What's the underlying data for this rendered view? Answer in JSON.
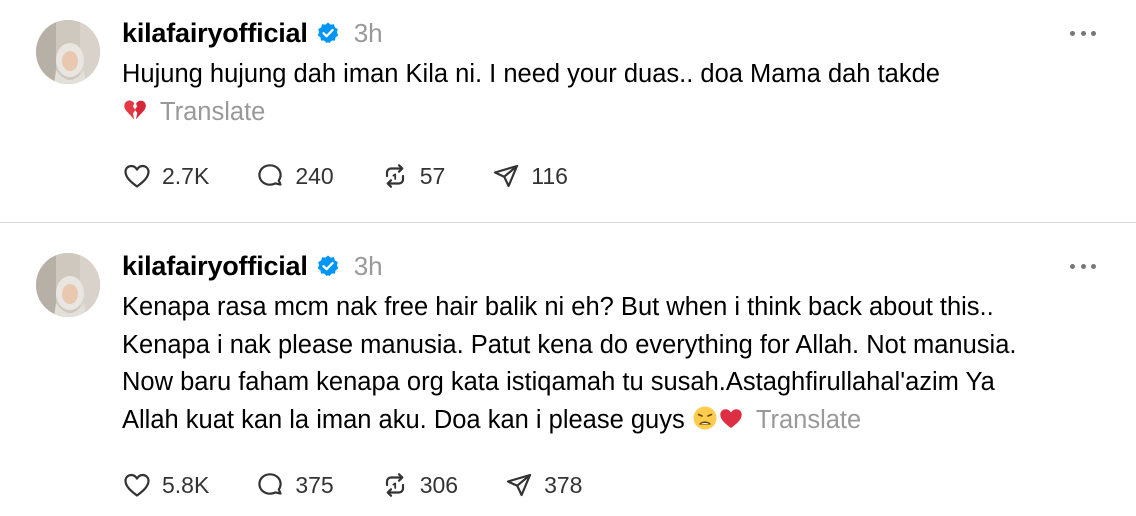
{
  "posts": [
    {
      "username": "kilafairyofficial",
      "time": "3h",
      "text": "Hujung hujung dah iman Kila ni. I need your duas.. doa Mama dah takde",
      "translate_label": "Translate",
      "emoji_trailing": "broken-heart",
      "counts": {
        "likes": "2.7K",
        "replies": "240",
        "reposts": "57",
        "shares": "116"
      }
    },
    {
      "username": "kilafairyofficial",
      "time": "3h",
      "lines": [
        "Kenapa rasa mcm nak free hair balik ni eh? But when i think back about this..",
        "Kenapa i nak please manusia. Patut kena do everything for Allah. Not manusia.",
        "Now baru faham kenapa org kata istiqamah tu susah.Astaghfirullahal'azim Ya",
        "Allah kuat kan la iman aku. Doa kan i please guys"
      ],
      "translate_label": "Translate",
      "emoji_trailing": [
        "weary-face",
        "red-heart"
      ],
      "counts": {
        "likes": "5.8K",
        "replies": "375",
        "reposts": "306",
        "shares": "378"
      }
    }
  ],
  "colors": {
    "verified": "#0095f6",
    "muted": "#999999",
    "divider": "#d9d9d9",
    "icon": "#333333"
  }
}
